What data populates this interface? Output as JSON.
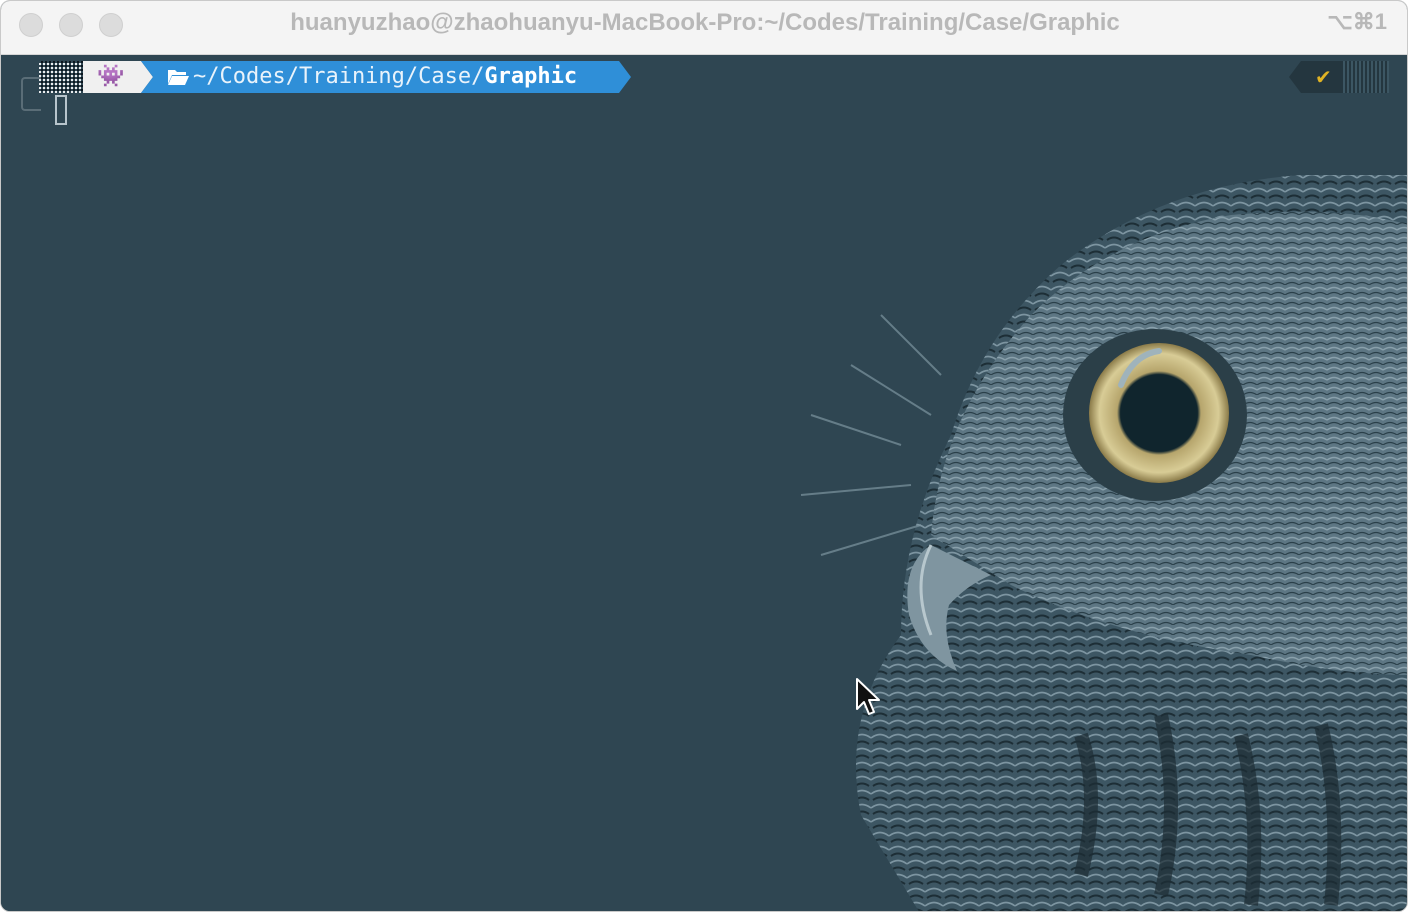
{
  "window": {
    "title": "huanyuzhao@zhaohuanyu-MacBook-Pro:~/Codes/Training/Case/Graphic",
    "shortcut": "⌥⌘1"
  },
  "prompt": {
    "os_icon": "alien-icon",
    "os_glyph": "👾",
    "folder_icon": "folder-open-icon",
    "path_prefix": "~/Codes/Training/Case/",
    "path_last": "Graphic",
    "status_glyph": "✔",
    "status_icon": "check-icon"
  },
  "colors": {
    "terminal_bg": "#2f4652",
    "path_segment": "#2f8fd8",
    "os_segment": "#f0f0f0",
    "status_check": "#e0b324"
  }
}
